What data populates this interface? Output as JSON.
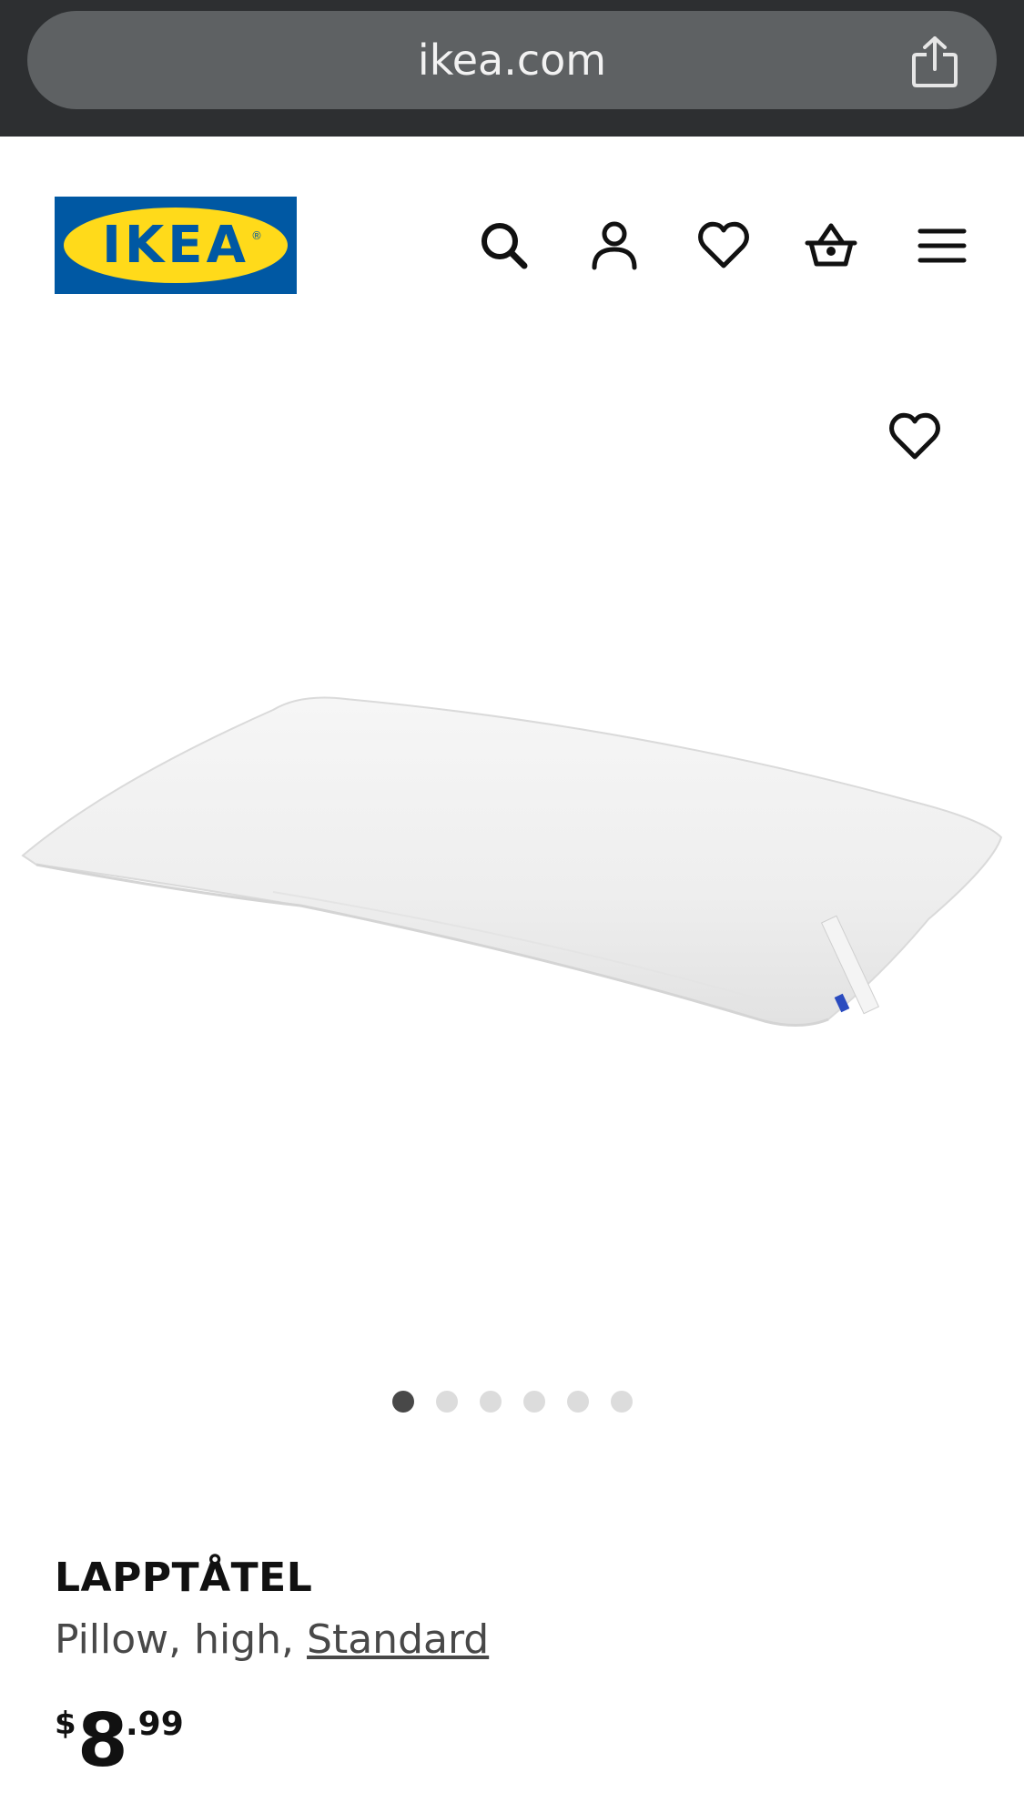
{
  "browser": {
    "url": "ikea.com",
    "share_icon": "share-icon"
  },
  "header": {
    "logo_text": "IKEA",
    "icons": [
      "search-icon",
      "account-icon",
      "heart-icon",
      "basket-icon",
      "menu-icon"
    ]
  },
  "gallery": {
    "favorite_icon": "heart-icon",
    "image_description_icon": "pillow-image",
    "dots_total": 6,
    "active_dot": 1
  },
  "product": {
    "name": "LAPPTÅTEL",
    "description_prefix": "Pillow, high, ",
    "variant": "Standard",
    "price": {
      "currency": "$",
      "integer": "8",
      "decimal": ".99"
    }
  },
  "colors": {
    "ikea_blue": "#0058a3",
    "ikea_yellow": "#ffda1a",
    "browser_bar": "#2d2f31",
    "url_pill": "#5e6163",
    "dot_active": "#484848",
    "dot_inactive": "#dcdcdc"
  }
}
